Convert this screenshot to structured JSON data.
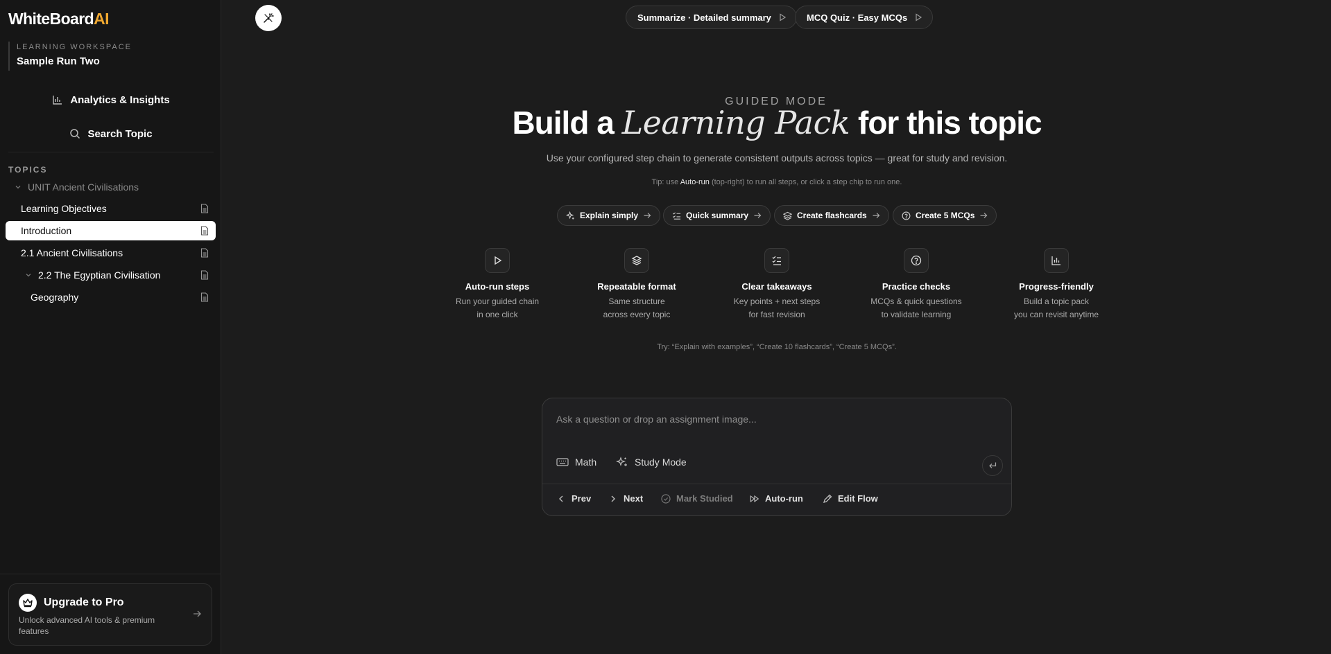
{
  "brand": {
    "name_main": "WhiteBoard",
    "name_accent": "AI"
  },
  "workspace": {
    "label": "LEARNING WORKSPACE",
    "name": "Sample Run Two"
  },
  "sidebar_actions": {
    "analytics": "Analytics & Insights",
    "search": "Search Topic"
  },
  "topics": {
    "label": "TOPICS",
    "unit": "UNIT Ancient Civilisations",
    "items": [
      {
        "label": "Learning Objectives"
      },
      {
        "label": "Introduction",
        "active": true
      },
      {
        "label": "2.1 Ancient Civilisations"
      },
      {
        "label": "2.2 The Egyptian Civilisation"
      },
      {
        "label": "Geography"
      }
    ]
  },
  "upgrade": {
    "title": "Upgrade to Pro",
    "subtitle": "Unlock advanced AI tools & premium features"
  },
  "top_pills": [
    {
      "label": "Summarize · Detailed summary"
    },
    {
      "label": "MCQ Quiz · Easy MCQs"
    }
  ],
  "hero": {
    "mode": "GUIDED MODE",
    "title_pre": "Build a ",
    "title_italic": "Learning Pack",
    "title_post": " for this topic",
    "subtitle": "Use your configured step chain to generate consistent outputs across topics — great for study and revision.",
    "tip_pre": "Tip: use ",
    "tip_bold": "Auto-run",
    "tip_post": " (top-right) to run all steps, or click a step chip to run one."
  },
  "chips": [
    {
      "label": "Explain simply",
      "icon": "sparkle-icon"
    },
    {
      "label": "Quick summary",
      "icon": "list-check-icon"
    },
    {
      "label": "Create flashcards",
      "icon": "layers-icon"
    },
    {
      "label": "Create 5 MCQs",
      "icon": "help-circle-icon"
    }
  ],
  "features": [
    {
      "title": "Auto-run steps",
      "line1": "Run your guided chain",
      "line2": "in one click",
      "icon": "play-icon"
    },
    {
      "title": "Repeatable format",
      "line1": "Same structure",
      "line2": "across every topic",
      "icon": "layers-icon"
    },
    {
      "title": "Clear takeaways",
      "line1": "Key points + next steps",
      "line2": "for fast revision",
      "icon": "list-check-icon"
    },
    {
      "title": "Practice checks",
      "line1": "MCQs & quick questions",
      "line2": "to validate learning",
      "icon": "help-circle-icon"
    },
    {
      "title": "Progress-friendly",
      "line1": "Build a topic pack",
      "line2": "you can revisit anytime",
      "icon": "bar-chart-icon"
    }
  ],
  "try_text": "Try: “Explain with examples”, “Create 10 flashcards”, “Create 5 MCQs”.",
  "composer": {
    "placeholder": "Ask a question or drop an assignment image...",
    "tools": {
      "math": "Math",
      "study_mode": "Study Mode"
    },
    "actions": {
      "prev": "Prev",
      "next": "Next",
      "mark_studied": "Mark Studied",
      "auto_run": "Auto-run",
      "edit_flow": "Edit Flow"
    }
  }
}
